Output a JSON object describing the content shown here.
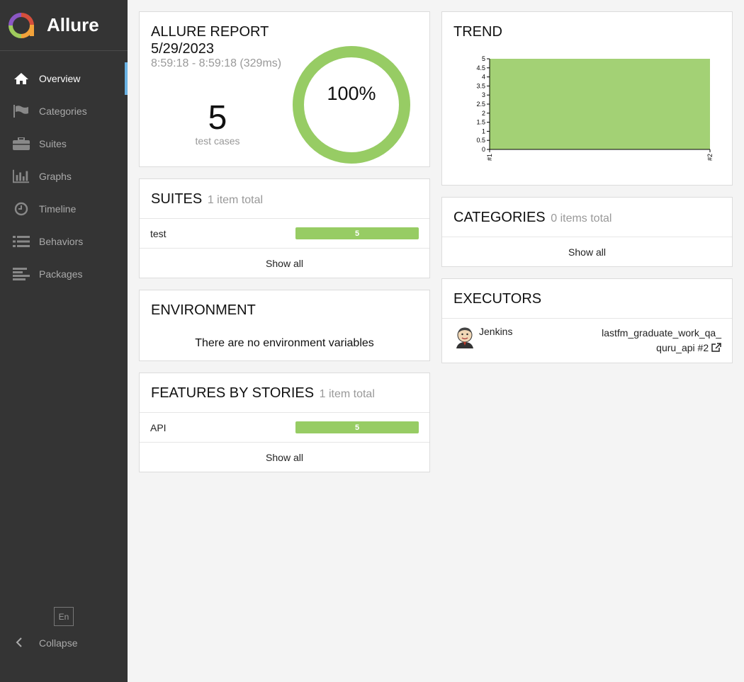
{
  "app": {
    "name": "Allure"
  },
  "sidebar": {
    "items": [
      {
        "label": "Overview",
        "icon": "home-icon",
        "active": true
      },
      {
        "label": "Categories",
        "icon": "flag-icon"
      },
      {
        "label": "Suites",
        "icon": "briefcase-icon"
      },
      {
        "label": "Graphs",
        "icon": "bar-chart-icon"
      },
      {
        "label": "Timeline",
        "icon": "clock-icon"
      },
      {
        "label": "Behaviors",
        "icon": "list-icon"
      },
      {
        "label": "Packages",
        "icon": "align-left-icon"
      }
    ],
    "language": "En",
    "collapse_label": "Collapse"
  },
  "summary": {
    "title_line1": "ALLURE REPORT",
    "title_line2": "5/29/2023",
    "time": "8:59:18 - 8:59:18 (329ms)",
    "count": "5",
    "count_label": "test cases",
    "percent": "100%",
    "pass_fraction": 1.0
  },
  "suites": {
    "title": "SUITES",
    "count": "1 item total",
    "items": [
      {
        "name": "test",
        "value": "5"
      }
    ],
    "show_all": "Show all"
  },
  "environment": {
    "title": "ENVIRONMENT",
    "empty_text": "There are no environment variables"
  },
  "features": {
    "title": "FEATURES BY STORIES",
    "count": "1 item total",
    "items": [
      {
        "name": "API",
        "value": "5"
      }
    ],
    "show_all": "Show all"
  },
  "trend": {
    "title": "TREND",
    "chart_data": {
      "type": "area",
      "x": [
        "#1",
        "#2"
      ],
      "series": [
        {
          "values": [
            5,
            5
          ]
        }
      ],
      "ylim": [
        0,
        5
      ],
      "yticks": [
        "0",
        "0.5",
        "1",
        "1.5",
        "2",
        "2.5",
        "3",
        "3.5",
        "4",
        "4.5",
        "5"
      ],
      "color": "#a3d175"
    }
  },
  "categories": {
    "title": "CATEGORIES",
    "count": "0 items total",
    "show_all": "Show all"
  },
  "executors": {
    "title": "EXECUTORS",
    "name": "Jenkins",
    "build_line1": "lastfm_graduate_work_qa_",
    "build_line2": "quru_api #2"
  },
  "colors": {
    "passed": "#97cc64",
    "sidebar": "#343434",
    "accent": "#6ab2e3"
  }
}
